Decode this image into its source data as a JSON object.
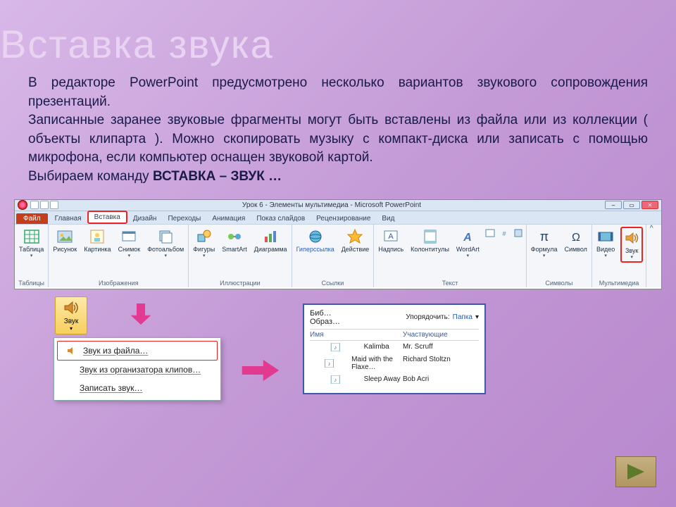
{
  "slide": {
    "title": "Вставка звука",
    "p1": "В редакторе PowerPoint предусмотрено несколько вариантов звукового сопровождения презентаций.",
    "p2": "Записанные заранее звуковые фрагменты могут быть вставлены из файла или из коллекции ( объекты клипарта ). Можно скопировать музыку с компакт-диска или записать с помощью микрофона, если компьютер оснащен звуковой картой.",
    "cmd_prefix": "Выбираем команду ",
    "cmd": "ВСТАВКА – ЗВУК …"
  },
  "window": {
    "title": "Урок 6 - Элементы мультимедиа - Microsoft PowerPoint"
  },
  "tabs": {
    "file": "Файл",
    "home": "Главная",
    "insert": "Вставка",
    "design": "Дизайн",
    "transitions": "Переходы",
    "animations": "Анимация",
    "slideshow": "Показ слайдов",
    "review": "Рецензирование",
    "view": "Вид"
  },
  "ribbon": {
    "tables": {
      "group": "Таблицы",
      "table": "Таблица"
    },
    "images": {
      "group": "Изображения",
      "picture": "Рисунок",
      "clipart": "Картинка",
      "screenshot": "Снимок",
      "album": "Фотоальбом"
    },
    "illus": {
      "group": "Иллюстрации",
      "shapes": "Фигуры",
      "smartart": "SmartArt",
      "chart": "Диаграмма"
    },
    "links": {
      "group": "Ссылки",
      "hyperlink": "Гиперссылка",
      "action": "Действие"
    },
    "text": {
      "group": "Текст",
      "textbox": "Надпись",
      "headerfooter": "Колонтитулы",
      "wordart": "WordArt",
      "more1": "",
      "more2": "",
      "more3": ""
    },
    "symbols": {
      "group": "Символы",
      "equation": "Формула",
      "symbol": "Символ"
    },
    "media": {
      "group": "Мультимедиа",
      "video": "Видео",
      "audio": "Звук"
    }
  },
  "sound_button": {
    "label": "Звук"
  },
  "sound_menu": {
    "from_file": "Звук из файла…",
    "from_organizer": "Звук из организатора клипов…",
    "record": "Записать звук…"
  },
  "file_dialog": {
    "crumb1": "Биб…",
    "crumb2": "Образ…",
    "sort_label": "Упорядочить:",
    "sort_value": "Папка",
    "col_name": "Имя",
    "col_artist": "Участвующие",
    "rows": [
      {
        "name": "Kalimba",
        "artist": "Mr. Scruff"
      },
      {
        "name": "Maid with the Flaxe…",
        "artist": "Richard Stoltzn"
      },
      {
        "name": "Sleep Away",
        "artist": "Bob Acri"
      }
    ]
  }
}
